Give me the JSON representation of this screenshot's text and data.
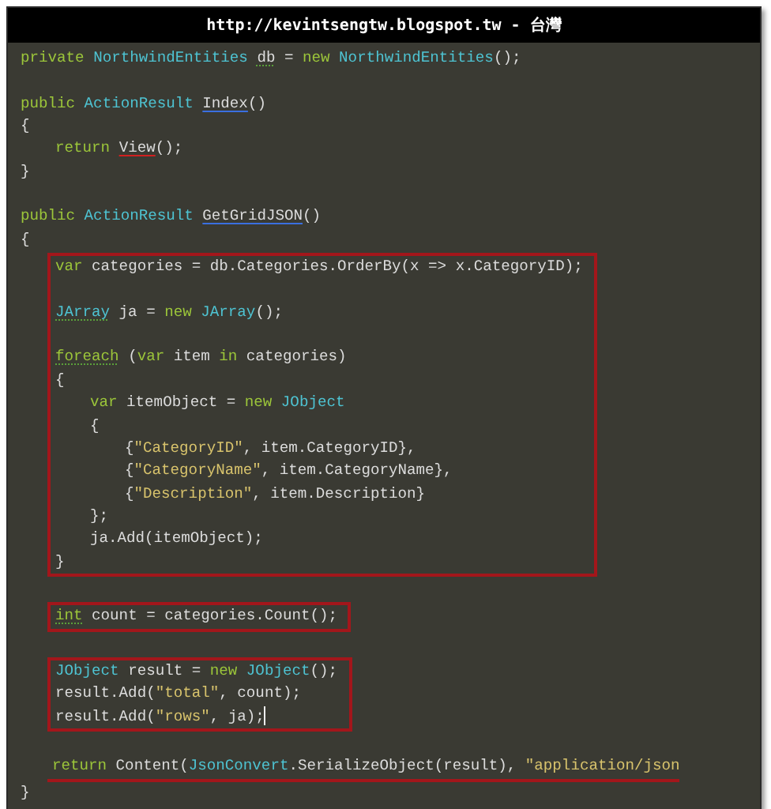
{
  "banner": {
    "text": "http://kevintsengtw.blogspot.tw - 台灣"
  },
  "code": [
    {
      "kind": "line",
      "tokens": [
        {
          "kind": "keyword",
          "text": "private"
        },
        {
          "kind": "type",
          "text": " NorthwindEntities"
        },
        {
          "kind": "plain",
          "text": " db",
          "underline": {
            "color": "#5aa03a",
            "dotted": true
          }
        },
        {
          "kind": "plain",
          "text": " = "
        },
        {
          "kind": "keyword",
          "text": "new"
        },
        {
          "kind": "type",
          "text": " NorthwindEntities"
        },
        {
          "kind": "plain",
          "text": "();"
        }
      ]
    },
    {
      "kind": "blank"
    },
    {
      "kind": "line",
      "tokens": [
        {
          "kind": "keyword",
          "text": "public"
        },
        {
          "kind": "type",
          "text": " ActionResult"
        },
        {
          "kind": "plain",
          "text": " Index",
          "underline": {
            "color": "#3a6fe0",
            "dotted": false
          }
        },
        {
          "kind": "plain",
          "text": "()"
        }
      ]
    },
    {
      "kind": "line",
      "tokens": [
        {
          "kind": "plain",
          "text": "{"
        }
      ],
      "children": [
        {
          "kind": "line",
          "tokens": [
            {
              "kind": "keyword",
              "text": "return"
            },
            {
              "kind": "plain",
              "text": " View",
              "underline": {
                "color": "#d02020",
                "dotted": false
              }
            },
            {
              "kind": "plain",
              "text": "();"
            }
          ]
        }
      ]
    },
    {
      "kind": "line",
      "tokens": [
        {
          "kind": "plain",
          "text": "}"
        }
      ]
    },
    {
      "kind": "blank"
    },
    {
      "kind": "line",
      "tokens": [
        {
          "kind": "keyword",
          "text": "public"
        },
        {
          "kind": "type",
          "text": " ActionResult"
        },
        {
          "kind": "plain",
          "text": " GetGridJSON",
          "underline": {
            "color": "#3a6fe0",
            "dotted": false
          }
        },
        {
          "kind": "plain",
          "text": "()"
        }
      ]
    },
    {
      "kind": "line",
      "tokens": [
        {
          "kind": "plain",
          "text": "{"
        }
      ],
      "children": [
        {
          "kind": "boxed",
          "lines": [
            {
              "kind": "line",
              "tokens": [
                {
                  "kind": "keyword",
                  "text": "var"
                },
                {
                  "kind": "plain",
                  "text": " categories = db.Categories.OrderBy(x => x.CategoryID);"
                }
              ]
            },
            {
              "kind": "blank"
            },
            {
              "kind": "line",
              "tokens": [
                {
                  "kind": "type",
                  "text": "JArray",
                  "underline": {
                    "color": "#5aa03a",
                    "dotted": true
                  }
                },
                {
                  "kind": "plain",
                  "text": " ja = "
                },
                {
                  "kind": "keyword",
                  "text": "new"
                },
                {
                  "kind": "type",
                  "text": " JArray"
                },
                {
                  "kind": "plain",
                  "text": "();"
                }
              ]
            },
            {
              "kind": "blank"
            },
            {
              "kind": "line",
              "tokens": [
                {
                  "kind": "keyword",
                  "text": "foreach",
                  "underline": {
                    "color": "#5aa03a",
                    "dotted": true
                  }
                },
                {
                  "kind": "plain",
                  "text": " ("
                },
                {
                  "kind": "keyword",
                  "text": "var"
                },
                {
                  "kind": "plain",
                  "text": " item "
                },
                {
                  "kind": "keyword",
                  "text": "in"
                },
                {
                  "kind": "plain",
                  "text": " categories)"
                }
              ]
            },
            {
              "kind": "line",
              "tokens": [
                {
                  "kind": "plain",
                  "text": "{"
                }
              ],
              "children": [
                {
                  "kind": "line",
                  "tokens": [
                    {
                      "kind": "keyword",
                      "text": "var"
                    },
                    {
                      "kind": "plain",
                      "text": " itemObject = "
                    },
                    {
                      "kind": "keyword",
                      "text": "new"
                    },
                    {
                      "kind": "type",
                      "text": " JObject"
                    }
                  ]
                },
                {
                  "kind": "line",
                  "tokens": [
                    {
                      "kind": "plain",
                      "text": "{"
                    }
                  ],
                  "children": [
                    {
                      "kind": "line",
                      "tokens": [
                        {
                          "kind": "plain",
                          "text": "{"
                        },
                        {
                          "kind": "string",
                          "text": "\"CategoryID\""
                        },
                        {
                          "kind": "plain",
                          "text": ", item.CategoryID},"
                        }
                      ]
                    },
                    {
                      "kind": "line",
                      "tokens": [
                        {
                          "kind": "plain",
                          "text": "{"
                        },
                        {
                          "kind": "string",
                          "text": "\"CategoryName\""
                        },
                        {
                          "kind": "plain",
                          "text": ", item.CategoryName},"
                        }
                      ]
                    },
                    {
                      "kind": "line",
                      "tokens": [
                        {
                          "kind": "plain",
                          "text": "{"
                        },
                        {
                          "kind": "string",
                          "text": "\"Description\""
                        },
                        {
                          "kind": "plain",
                          "text": ", item.Description}"
                        }
                      ]
                    }
                  ]
                },
                {
                  "kind": "line",
                  "tokens": [
                    {
                      "kind": "plain",
                      "text": "};"
                    }
                  ]
                },
                {
                  "kind": "line",
                  "tokens": [
                    {
                      "kind": "plain",
                      "text": "ja.Add(itemObject);"
                    }
                  ]
                }
              ]
            },
            {
              "kind": "line",
              "tokens": [
                {
                  "kind": "plain",
                  "text": "}"
                }
              ]
            }
          ]
        },
        {
          "kind": "blank"
        },
        {
          "kind": "boxed",
          "lines": [
            {
              "kind": "line",
              "tokens": [
                {
                  "kind": "keyword",
                  "text": "int",
                  "underline": {
                    "color": "#5aa03a",
                    "dotted": true
                  }
                },
                {
                  "kind": "plain",
                  "text": " count = categories.Count();"
                }
              ]
            }
          ]
        },
        {
          "kind": "blank"
        },
        {
          "kind": "boxed",
          "lines": [
            {
              "kind": "line",
              "tokens": [
                {
                  "kind": "type",
                  "text": "JObject"
                },
                {
                  "kind": "plain",
                  "text": " result = "
                },
                {
                  "kind": "keyword",
                  "text": "new"
                },
                {
                  "kind": "type",
                  "text": " JObject"
                },
                {
                  "kind": "plain",
                  "text": "();"
                }
              ]
            },
            {
              "kind": "line",
              "tokens": [
                {
                  "kind": "plain",
                  "text": "result.Add("
                },
                {
                  "kind": "string",
                  "text": "\"total\""
                },
                {
                  "kind": "plain",
                  "text": ", count);"
                }
              ]
            },
            {
              "kind": "line",
              "tokens": [
                {
                  "kind": "plain",
                  "text": "result.Add("
                },
                {
                  "kind": "string",
                  "text": "\"rows\""
                },
                {
                  "kind": "plain",
                  "text": ", ja);"
                },
                {
                  "kind": "caret"
                }
              ]
            }
          ]
        },
        {
          "kind": "blank"
        },
        {
          "kind": "underlined",
          "lines": [
            {
              "kind": "line",
              "tokens": [
                {
                  "kind": "keyword",
                  "text": "return"
                },
                {
                  "kind": "plain",
                  "text": " Content("
                },
                {
                  "kind": "type",
                  "text": "JsonConvert"
                },
                {
                  "kind": "plain",
                  "text": ".SerializeObject(result), "
                },
                {
                  "kind": "string",
                  "text": "\"application/json"
                }
              ]
            }
          ]
        }
      ]
    },
    {
      "kind": "line",
      "tokens": [
        {
          "kind": "plain",
          "text": "}"
        }
      ]
    }
  ]
}
